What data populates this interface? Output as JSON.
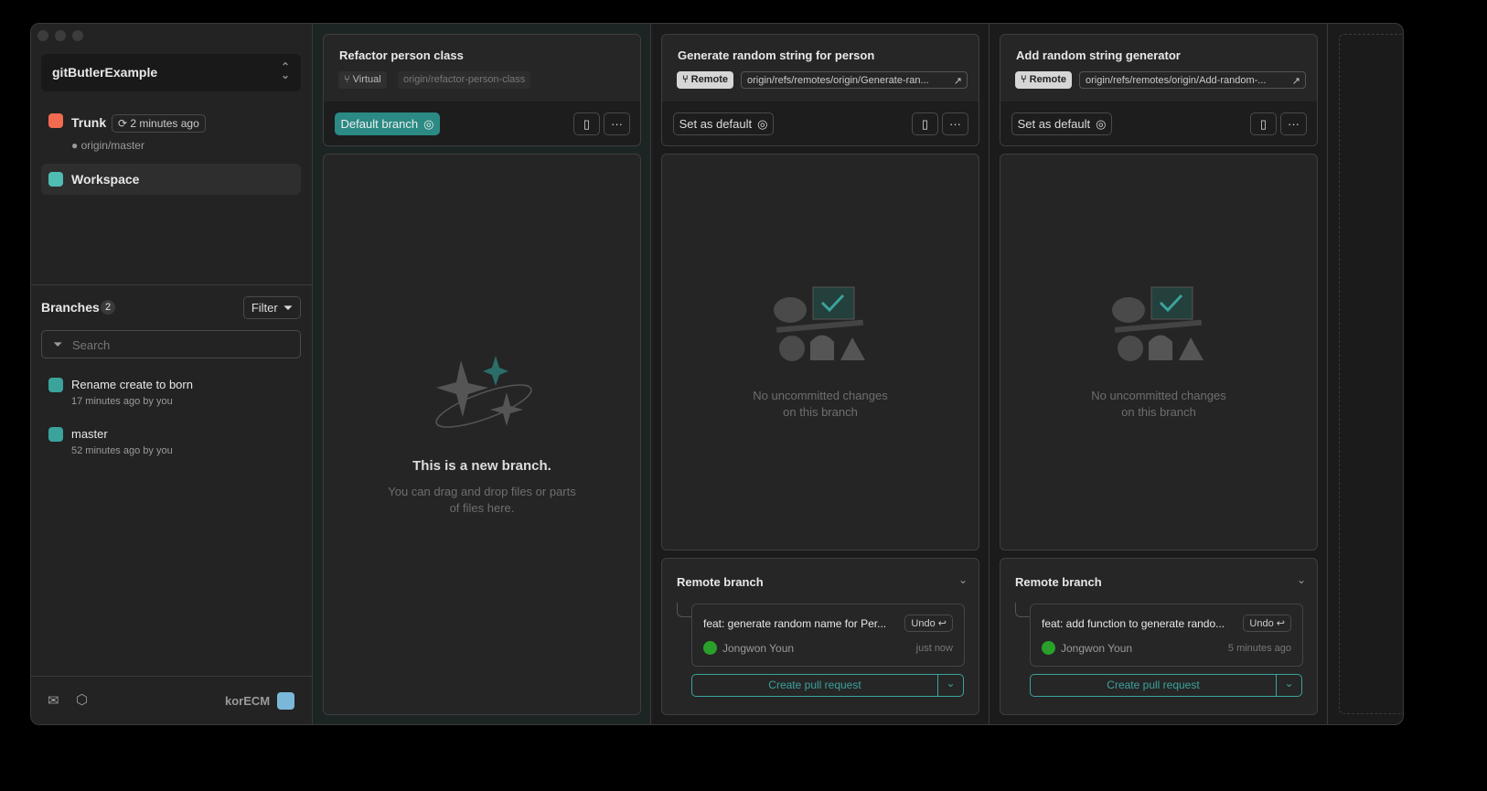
{
  "sidebar": {
    "project": "gitButlerExample",
    "trunk": {
      "label": "Trunk",
      "sync": "2 minutes ago",
      "remote": "origin/master"
    },
    "workspace": "Workspace",
    "branches": {
      "title": "Branches",
      "count": "2",
      "filter": "Filter",
      "search_placeholder": "Search",
      "items": [
        {
          "name": "Rename create to born",
          "meta": "17 minutes ago by you"
        },
        {
          "name": "master",
          "meta": "52 minutes ago by you"
        }
      ]
    },
    "user": "korECM"
  },
  "lanes": [
    {
      "title": "Refactor person class",
      "tag": "Virtual",
      "ref": "origin/refactor-person-class",
      "default_btn": "Default branch",
      "empty_title": "This is a new branch.",
      "empty_text1": "You can drag and drop files or parts",
      "empty_text2": "of files here."
    },
    {
      "title": "Generate random string for person",
      "tag": "Remote",
      "ref": "origin/refs/remotes/origin/Generate-ran...",
      "default_btn": "Set as default",
      "empty_text1": "No uncommitted changes",
      "empty_text2": "on this branch",
      "remote_title": "Remote branch",
      "commit": "feat: generate random name for Per...",
      "undo": "Undo",
      "author": "Jongwon Youn",
      "time": "just now",
      "pr": "Create pull request"
    },
    {
      "title": "Add random string generator",
      "tag": "Remote",
      "ref": "origin/refs/remotes/origin/Add-random-...",
      "default_btn": "Set as default",
      "empty_text1": "No uncommitted changes",
      "empty_text2": "on this branch",
      "remote_title": "Remote branch",
      "commit": "feat: add function to generate rando...",
      "undo": "Undo",
      "author": "Jongwon Youn",
      "time": "5 minutes ago",
      "pr": "Create pull request"
    }
  ],
  "colors": {
    "accent": "#2b8a84",
    "trunk": "#f26a4f"
  }
}
